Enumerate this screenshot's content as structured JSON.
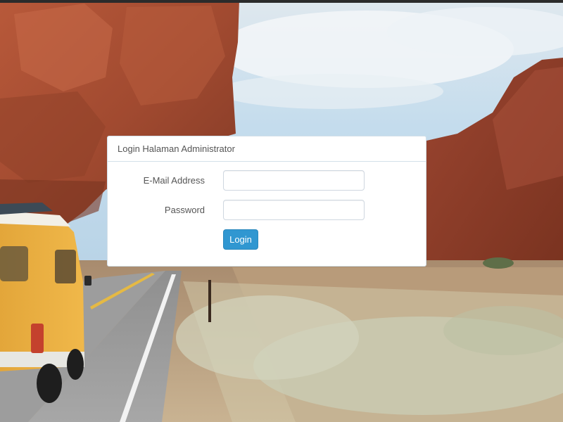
{
  "login_panel": {
    "heading": "Login Halaman Administrator",
    "email_label": "E-Mail Address",
    "email_value": "",
    "password_label": "Password",
    "password_value": "",
    "login_button": "Login"
  },
  "colors": {
    "primary_button": "#3097d1",
    "panel_border": "#d3e0e9",
    "label_text": "#555555"
  }
}
